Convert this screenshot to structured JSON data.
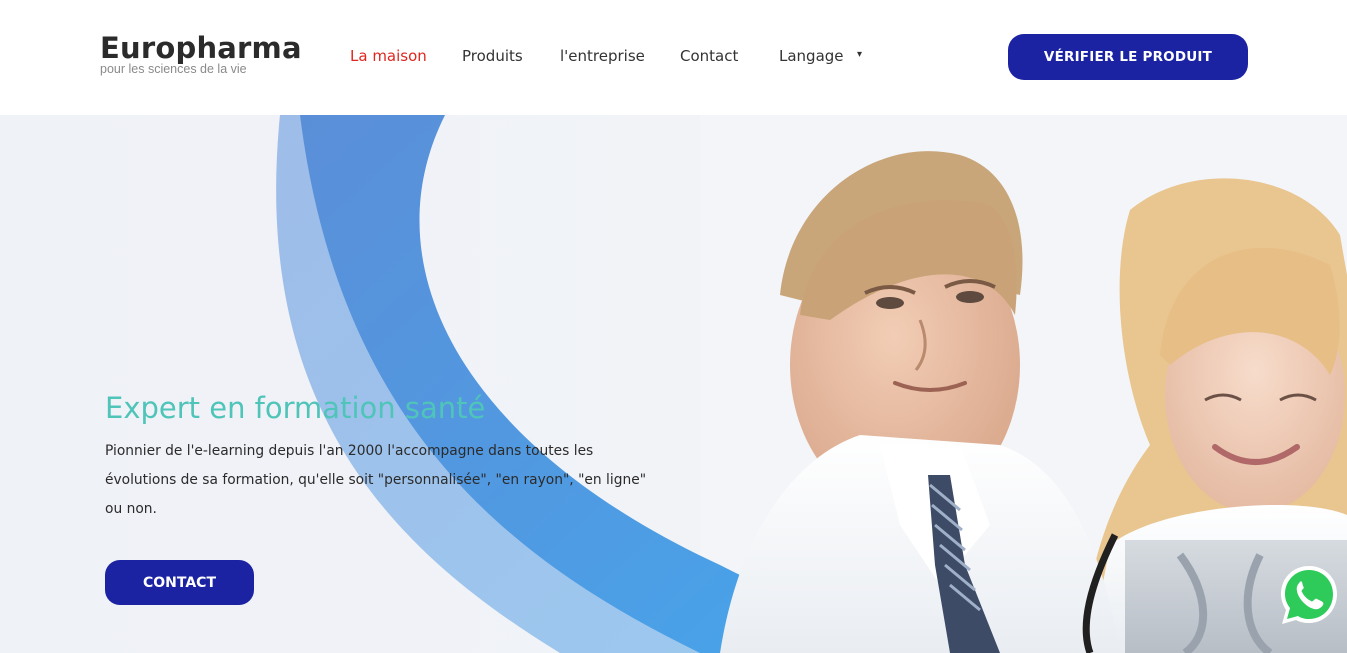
{
  "brand": {
    "name": "Europharma",
    "tagline": "pour les sciences de la vie"
  },
  "nav": {
    "items": [
      {
        "label": "La maison",
        "active": true
      },
      {
        "label": "Produits"
      },
      {
        "label": "l'entreprise"
      },
      {
        "label": "Contact"
      },
      {
        "label": "Langage"
      }
    ],
    "caret": "▾"
  },
  "header": {
    "verify_label": "VÉRIFIER LE PRODUIT"
  },
  "hero": {
    "title": "Expert en formation santé",
    "text": "Pionnier de l'e-learning depuis l'an 2000 l'accompagne dans toutes les évolutions de sa formation, qu'elle soit \"personnalisée\", \"en rayon\", \"en ligne\" ou non.",
    "contact_label": "CONTACT"
  },
  "colors": {
    "primary": "#1b23a3",
    "active_nav": "#e0261f",
    "hero_title": "#4fc4b8",
    "swoosh": "#4a86d6"
  },
  "icons": {
    "whatsapp": "whatsapp-icon"
  }
}
